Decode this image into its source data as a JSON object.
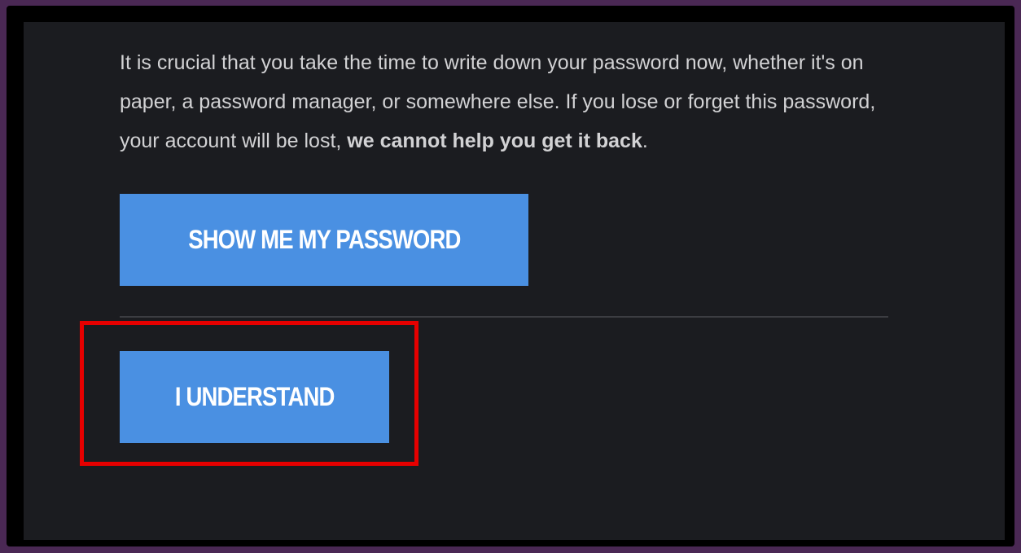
{
  "message": {
    "line1": "It is crucial that you take the time to write down your password now, whether it's on",
    "line2": "paper, a password manager, or somewhere else. If you lose or forget this password,",
    "line3_prefix": "your account will be lost, ",
    "line3_bold": "we cannot help you get it back",
    "line3_suffix": "."
  },
  "buttons": {
    "show_password_label": "SHOW ME MY PASSWORD",
    "understand_label": "I UNDERSTAND"
  },
  "colors": {
    "page_background": "#4a2854",
    "panel_background": "#1b1c20",
    "button_accent": "#4a90e2",
    "highlight": "#e60000",
    "text": "#d2d2d4"
  }
}
